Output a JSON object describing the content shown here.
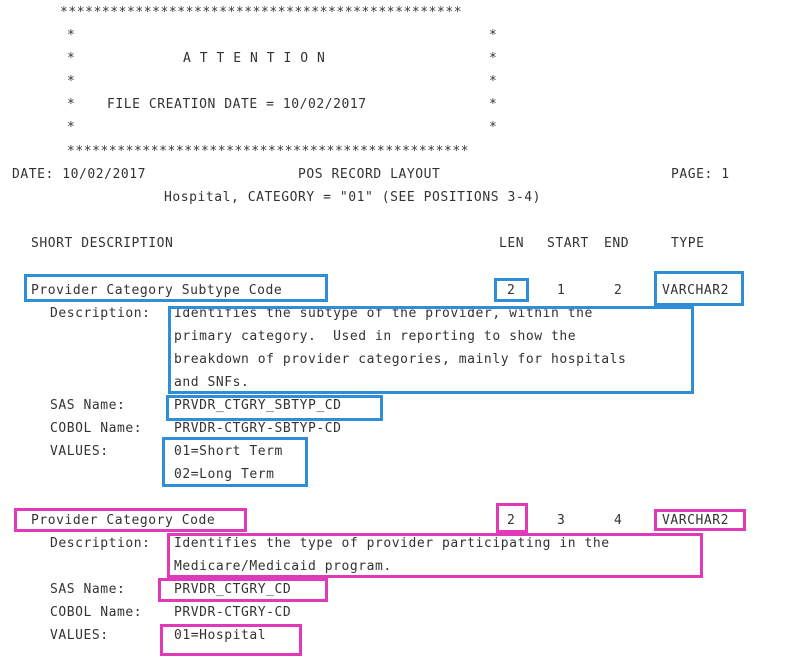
{
  "banner": {
    "border_line": "************************************************",
    "star": "*",
    "heading": "A T T E N T I O N",
    "file_creation": "FILE CREATION DATE = 10/02/2017"
  },
  "header": {
    "date": "DATE: 10/02/2017",
    "title": "POS RECORD LAYOUT",
    "page": "PAGE: 1",
    "subtitle": "Hospital, CATEGORY = \"01\" (SEE POSITIONS 3-4)"
  },
  "columns": {
    "short_description": "SHORT DESCRIPTION",
    "len": "LEN",
    "start": "START",
    "end": "END",
    "type": "TYPE"
  },
  "labels": {
    "description": "Description:",
    "sas_name": "SAS Name:",
    "cobol_name": "COBOL Name:",
    "values": "VALUES:"
  },
  "fields": [
    {
      "name": "Provider Category Subtype Code",
      "len": "2",
      "start": "1",
      "end": "2",
      "type": "VARCHAR2",
      "description_lines": [
        "Identifies the subtype of the provider, within the",
        "primary category.  Used in reporting to show the",
        "breakdown of provider categories, mainly for hospitals",
        "and SNFs."
      ],
      "sas_name": "PRVDR_CTGRY_SBTYP_CD",
      "cobol_name": "PRVDR-CTGRY-SBTYP-CD",
      "values": [
        "01=Short Term",
        "02=Long Term"
      ]
    },
    {
      "name": "Provider Category Code",
      "len": "2",
      "start": "3",
      "end": "4",
      "type": "VARCHAR2",
      "description_lines": [
        "Identifies the type of provider participating in the",
        "Medicare/Medicaid program."
      ],
      "sas_name": "PRVDR_CTGRY_CD",
      "cobol_name": "PRVDR-CTGRY-CD",
      "values": [
        "01=Hospital"
      ]
    }
  ],
  "colors": {
    "highlight_field_1": "#2e8fd8",
    "highlight_field_2": "#e03ab8",
    "text": "#333333"
  }
}
